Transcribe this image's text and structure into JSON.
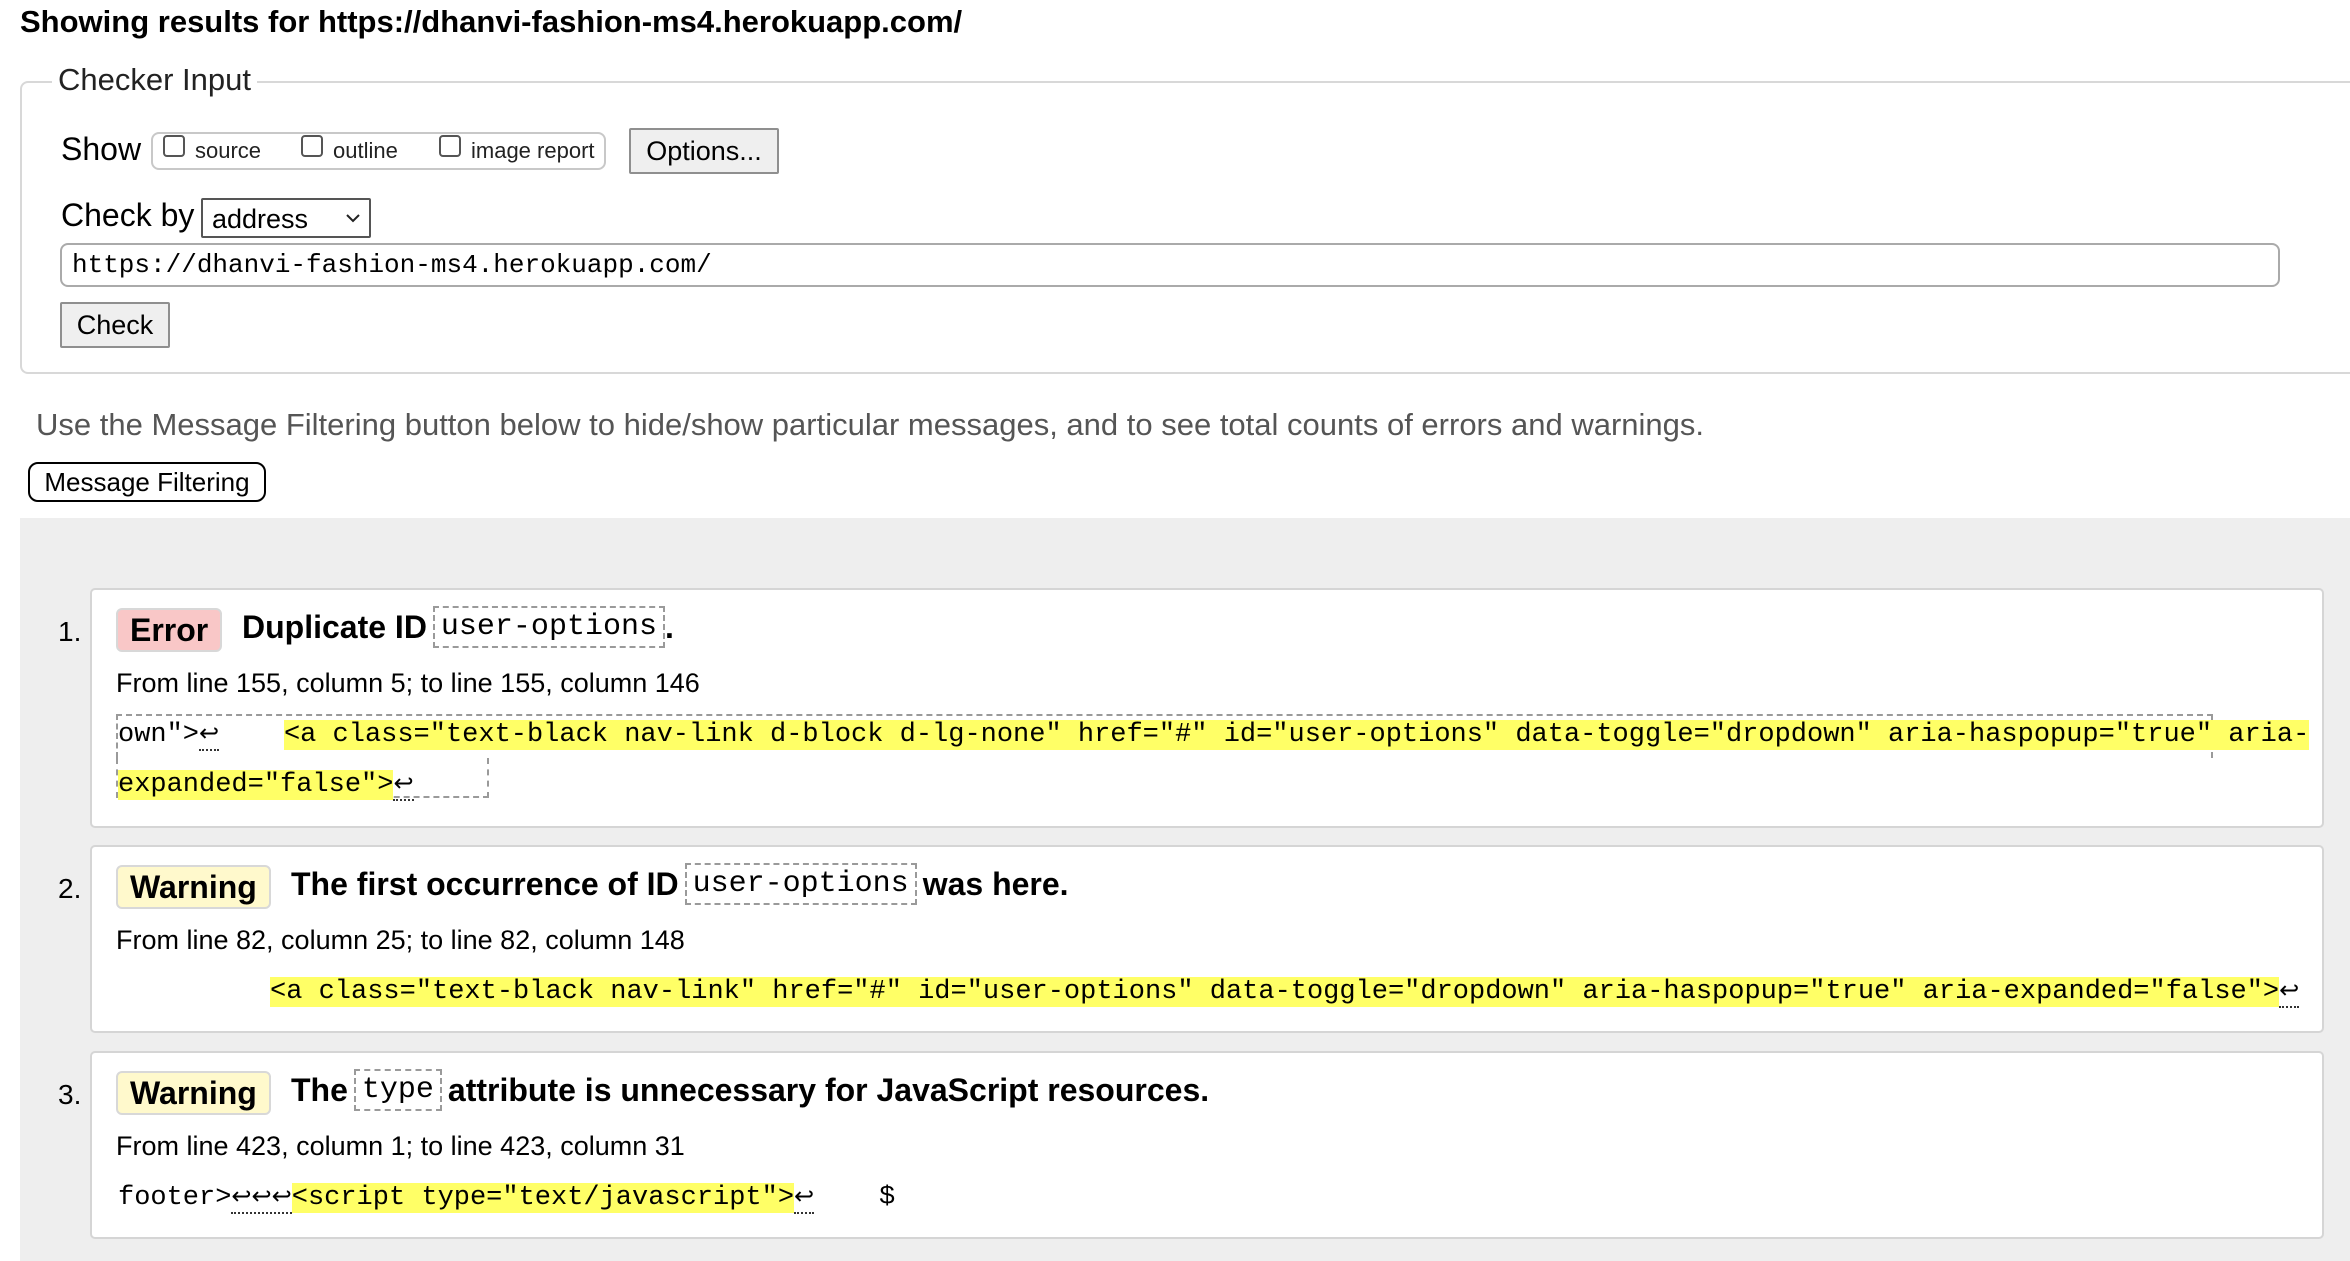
{
  "page_title": "Showing results for https://dhanvi-fashion-ms4.herokuapp.com/",
  "checker": {
    "legend": "Checker Input",
    "show_label": "Show",
    "checkboxes": [
      {
        "label": "source",
        "checked": false
      },
      {
        "label": "outline",
        "checked": false
      },
      {
        "label": "image report",
        "checked": false
      }
    ],
    "options_label": "Options...",
    "check_by_label": "Check by",
    "check_by_value": "address",
    "url_value": "https://dhanvi-fashion-ms4.herokuapp.com/",
    "check_label": "Check"
  },
  "filter_note": "Use the Message Filtering button below to hide/show particular messages, and to see total counts of errors and warnings.",
  "filter_button_label": "Message Filtering",
  "messages": [
    {
      "number": "1.",
      "type": "Error",
      "title_pre": "Duplicate ID",
      "title_code": "user-options",
      "title_post": ".",
      "location": "From line 155, column 5; to line 155, column 146",
      "extract_pre": "own\">",
      "extract_ret1": "↩",
      "extract_gap": "    ",
      "extract_hl1": "<a class=\"text-black nav-link d-block d-lg-none\" href=\"#\" id=\"user-options\" data-toggle=\"dropdown\" aria-haspopup=\"true\" aria-",
      "extract_hl2": "expanded=\"false\">",
      "extract_ret2": "↩"
    },
    {
      "number": "2.",
      "type": "Warning",
      "title_pre": "The first occurrence of ID",
      "title_code": "user-options",
      "title_post": "was here.",
      "location": "From line 82, column 25; to line 82, column 148",
      "extract_hl": "<a class=\"text-black nav-link\" href=\"#\" id=\"user-options\" data-toggle=\"dropdown\" aria-haspopup=\"true\" aria-expanded=\"false\">",
      "extract_ret": "↩"
    },
    {
      "number": "3.",
      "type": "Warning",
      "title_pre": "The",
      "title_code": "type",
      "title_post": "attribute is unnecessary for JavaScript resources.",
      "location": "From line 423, column 1; to line 423, column 31",
      "extract_pre": "footer>",
      "extract_rets": "↩↩↩",
      "extract_hl": "<script type=\"text/javascript\">",
      "extract_ret": "↩",
      "extract_post": "    $"
    }
  ],
  "colors": {
    "error_badge": "#f9c7c7",
    "warning_badge": "#fff9cc",
    "highlight": "#ffff66",
    "results_bg": "#eeeeee"
  }
}
